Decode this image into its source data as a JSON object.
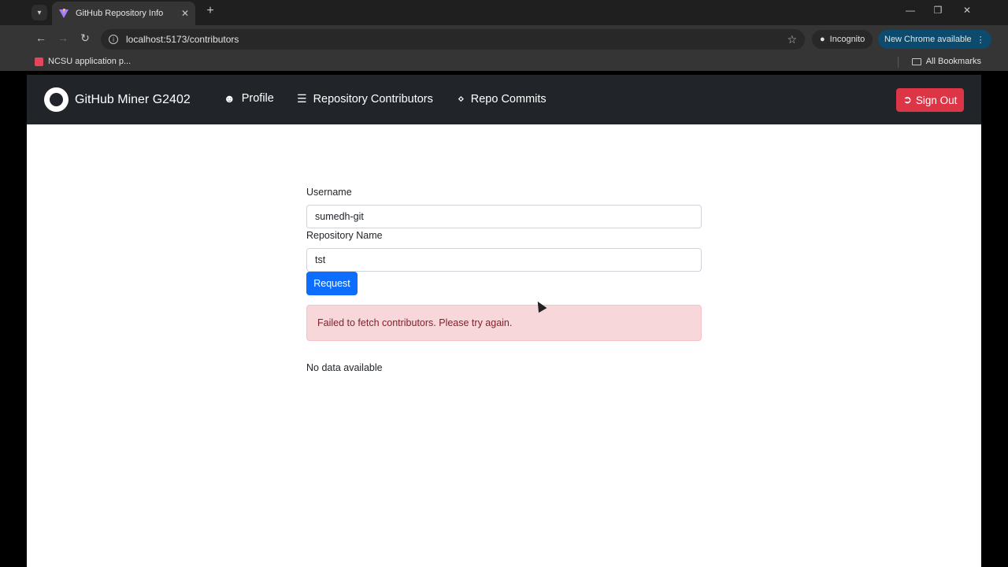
{
  "browser": {
    "tab_title": "GitHub Repository Info",
    "url": "localhost:5173/contributors",
    "incognito_label": "Incognito",
    "update_label": "New Chrome available",
    "bookmark_label": "NCSU application p...",
    "all_bookmarks_label": "All Bookmarks"
  },
  "navbar": {
    "brand": "GitHub Miner G2402",
    "links": [
      "Profile",
      "Repository Contributors",
      "Repo Commits"
    ],
    "signout_label": "Sign Out"
  },
  "form": {
    "username_label": "Username",
    "username_value": "sumedh-git",
    "repo_label": "Repository Name",
    "repo_value": "tst",
    "request_label": "Request"
  },
  "alert": {
    "message": "Failed to fetch contributors. Please try again."
  },
  "result": {
    "empty_text": "No data available"
  },
  "colors": {
    "navbar_bg": "#212529",
    "signout_bg": "#dc3545",
    "request_bg": "#0d6efd",
    "alert_bg": "#f8d7da",
    "alert_text": "#842029"
  }
}
